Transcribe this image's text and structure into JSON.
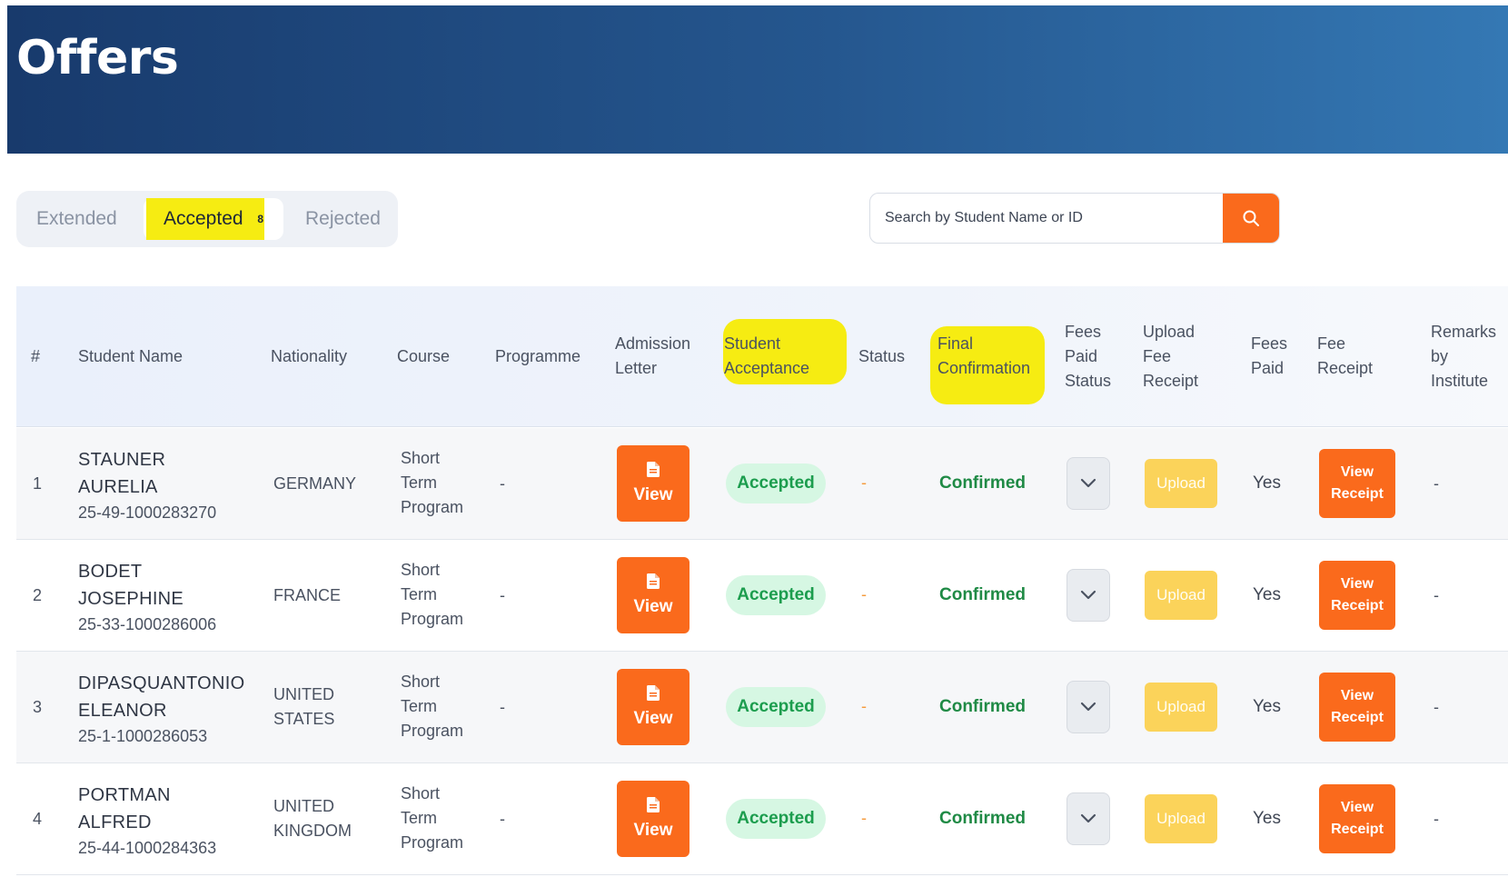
{
  "header": {
    "title": "Offers"
  },
  "tabs": [
    {
      "label": "Extended"
    },
    {
      "label": "Accepted",
      "count": "8"
    },
    {
      "label": "Rejected"
    }
  ],
  "search": {
    "placeholder": "Search by Student Name or ID"
  },
  "table": {
    "columns": [
      {
        "label": "#"
      },
      {
        "label": "Student Name"
      },
      {
        "label": "Nationality"
      },
      {
        "label": "Course"
      },
      {
        "label": "Programme"
      },
      {
        "label": [
          "Admission",
          "Letter"
        ]
      },
      {
        "label": [
          "Student",
          "Acceptance"
        ]
      },
      {
        "label": "Status"
      },
      {
        "label": [
          "Final",
          "Confirmation"
        ]
      },
      {
        "label": [
          "Fees",
          "Paid",
          "Status"
        ]
      },
      {
        "label": [
          "Upload",
          "Fee",
          "Receipt"
        ]
      },
      {
        "label": [
          "Fees",
          "Paid"
        ]
      },
      {
        "label": [
          "Fee",
          "Receipt"
        ]
      },
      {
        "label": [
          "Remarks",
          "by",
          "Institute"
        ]
      }
    ],
    "rows": [
      {
        "num": "1",
        "name_line1": "STAUNER",
        "name_line2": "AURELIA",
        "student_id": "25-49-1000283270",
        "nationality": [
          "GERMANY"
        ],
        "course": [
          "Short",
          "Term",
          "Program"
        ],
        "programme": "-",
        "admission_letter": "View",
        "student_acceptance": "Accepted",
        "status": "-",
        "final_confirmation": "Confirmed",
        "upload_label": "Upload",
        "fees_paid": "Yes",
        "receipt_label": [
          "View",
          "Receipt"
        ],
        "remarks": "-"
      },
      {
        "num": "2",
        "name_line1": "BODET",
        "name_line2": "JOSEPHINE",
        "student_id": "25-33-1000286006",
        "nationality": [
          "FRANCE"
        ],
        "course": [
          "Short",
          "Term",
          "Program"
        ],
        "programme": "-",
        "admission_letter": "View",
        "student_acceptance": "Accepted",
        "status": "-",
        "final_confirmation": "Confirmed",
        "upload_label": "Upload",
        "fees_paid": "Yes",
        "receipt_label": [
          "View",
          "Receipt"
        ],
        "remarks": "-"
      },
      {
        "num": "3",
        "name_line1": "DIPASQUANTONIO",
        "name_line2": "ELEANOR",
        "student_id": "25-1-1000286053",
        "nationality": [
          "UNITED",
          "STATES"
        ],
        "course": [
          "Short",
          "Term",
          "Program"
        ],
        "programme": "-",
        "admission_letter": "View",
        "student_acceptance": "Accepted",
        "status": "-",
        "final_confirmation": "Confirmed",
        "upload_label": "Upload",
        "fees_paid": "Yes",
        "receipt_label": [
          "View",
          "Receipt"
        ],
        "remarks": "-"
      },
      {
        "num": "4",
        "name_line1": "PORTMAN",
        "name_line2": "ALFRED",
        "student_id": "25-44-1000284363",
        "nationality": [
          "UNITED",
          "KINGDOM"
        ],
        "course": [
          "Short",
          "Term",
          "Program"
        ],
        "programme": "-",
        "admission_letter": "View",
        "student_acceptance": "Accepted",
        "status": "-",
        "final_confirmation": "Confirmed",
        "upload_label": "Upload",
        "fees_paid": "Yes",
        "receipt_label": [
          "View",
          "Receipt"
        ],
        "remarks": "-"
      }
    ]
  },
  "icons": {
    "search": "search-icon",
    "document": "document-icon",
    "dropdown": "chevron-down-icon"
  },
  "colors": {
    "header_start": "#183a6c",
    "header_end": "#3478b4",
    "accent": "#fa6a1c",
    "highlight": "#f6ec12",
    "accepted_bg": "#d6f7e3",
    "accepted_text": "#1c9d4e",
    "confirmed_text": "#1f8a45",
    "upload_bg": "#fbd35a"
  }
}
